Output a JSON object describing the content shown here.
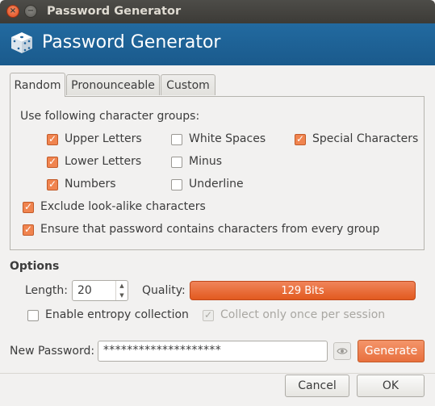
{
  "window": {
    "title": "Password Generator",
    "close_glyph": "×",
    "minimize_glyph": "−"
  },
  "header": {
    "title": "Password Generator",
    "icon": "dice-icon"
  },
  "tabs": [
    {
      "label": "Random",
      "active": true
    },
    {
      "label": "Pronounceable",
      "active": false
    },
    {
      "label": "Custom",
      "active": false
    }
  ],
  "random": {
    "groups_heading": "Use following character groups:",
    "groups": {
      "upper_letters": {
        "label": "Upper Letters",
        "checked": true
      },
      "lower_letters": {
        "label": "Lower Letters",
        "checked": true
      },
      "numbers": {
        "label": "Numbers",
        "checked": true
      },
      "white_spaces": {
        "label": "White Spaces",
        "checked": false
      },
      "minus": {
        "label": "Minus",
        "checked": false
      },
      "underline": {
        "label": "Underline",
        "checked": false
      },
      "special_characters": {
        "label": "Special Characters",
        "checked": true
      }
    },
    "exclude_lookalike": {
      "label": "Exclude look-alike characters",
      "checked": true
    },
    "every_group": {
      "label": "Ensure that password contains characters from every group",
      "checked": true
    }
  },
  "options": {
    "heading": "Options",
    "length_label": "Length:",
    "length_value": "20",
    "quality_label": "Quality:",
    "quality_value": "129 Bits",
    "entropy": {
      "label": "Enable entropy collection",
      "checked": false
    },
    "collect_once": {
      "label": "Collect only once per session",
      "checked": true,
      "enabled": false
    }
  },
  "new_password": {
    "label": "New Password:",
    "value": "********************",
    "generate_label": "Generate"
  },
  "footer": {
    "cancel_label": "Cancel",
    "ok_label": "OK"
  },
  "colors": {
    "accent": "#e8703e",
    "header": "#1f629a",
    "titlebar": "#3c3b37"
  }
}
